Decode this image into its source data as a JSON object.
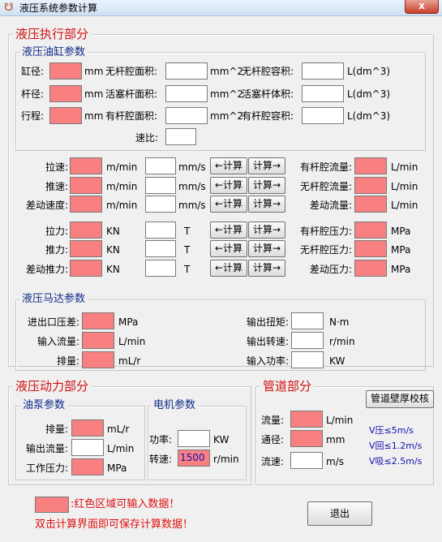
{
  "window": {
    "title": "液压系统参数计算",
    "icon": "app-icon",
    "close_label": "x"
  },
  "cylinder_section": {
    "title": "液压执行部分",
    "cyl_params": {
      "title": "液压油缸参数",
      "rows": [
        {
          "label": "缸径:",
          "unit": "mm",
          "mid_label": "无杆腔面积:",
          "mid_unit": "mm^2",
          "right_label": "无杆腔容积:",
          "right_unit": "L(dm^3)"
        },
        {
          "label": "杆径:",
          "unit": "mm",
          "mid_label": "活塞杆面积:",
          "mid_unit": "mm^2",
          "right_label": "活塞杆体积:",
          "right_unit": "L(dm^3)"
        },
        {
          "label": "行程:",
          "unit": "mm",
          "mid_label": "有杆腔面积:",
          "mid_unit": "mm^2",
          "right_label": "有杆腔容积:",
          "right_unit": "L(dm^3)"
        }
      ],
      "speed_ratio_label": "速比:"
    },
    "speed_rows": [
      {
        "label": "拉速:",
        "unit1": "m/min",
        "unit2": "mm/s",
        "btn_left": "←计算",
        "btn_right": "计算→",
        "right_label": "有杆腔流量:",
        "right_unit": "L/min"
      },
      {
        "label": "推速:",
        "unit1": "m/min",
        "unit2": "mm/s",
        "btn_left": "←计算",
        "btn_right": "计算→",
        "right_label": "无杆腔流量:",
        "right_unit": "L/min"
      },
      {
        "label": "差动速度:",
        "unit1": "m/min",
        "unit2": "mm/s",
        "btn_left": "←计算",
        "btn_right": "计算→",
        "right_label": "差动流量:",
        "right_unit": "L/min"
      }
    ],
    "force_rows": [
      {
        "label": "拉力:",
        "unit1": "KN",
        "unit2": "T",
        "btn_left": "←计算",
        "btn_right": "计算→",
        "right_label": "有杆腔压力:",
        "right_unit": "MPa"
      },
      {
        "label": "推力:",
        "unit1": "KN",
        "unit2": "T",
        "btn_left": "←计算",
        "btn_right": "计算→",
        "right_label": "无杆腔压力:",
        "right_unit": "MPa"
      },
      {
        "label": "差动推力:",
        "unit1": "KN",
        "unit2": "T",
        "btn_left": "←计算",
        "btn_right": "计算→",
        "right_label": "差动压力:",
        "right_unit": "MPa"
      }
    ]
  },
  "motor_section": {
    "title": "液压马达参数",
    "left_rows": [
      {
        "label": "进出口压差:",
        "unit": "MPa"
      },
      {
        "label": "输入流量:",
        "unit": "L/min"
      },
      {
        "label": "排量:",
        "unit": "mL/r"
      }
    ],
    "right_rows": [
      {
        "label": "输出扭矩:",
        "unit": "N·m"
      },
      {
        "label": "输出转速:",
        "unit": "r/min"
      },
      {
        "label": "输入功率:",
        "unit": "KW"
      }
    ]
  },
  "power_section": {
    "title": "液压动力部分",
    "pump": {
      "title": "油泵参数",
      "rows": [
        {
          "label": "排量:",
          "unit": "mL/r"
        },
        {
          "label": "输出流量:",
          "unit": "L/min"
        },
        {
          "label": "工作压力:",
          "unit": "MPa"
        }
      ]
    },
    "motor": {
      "title": "电机参数",
      "power_label": "功率:",
      "power_unit": "KW",
      "speed_label": "转速:",
      "speed_value": "1500",
      "speed_unit": "r/min"
    }
  },
  "pipe_section": {
    "title": "管道部分",
    "check_button": "管道壁厚校核",
    "rows": [
      {
        "label": "流量:",
        "unit": "L/min"
      },
      {
        "label": "通径:",
        "unit": "mm"
      },
      {
        "label": "流速:",
        "unit": "m/s"
      }
    ],
    "notes": [
      "V压≤5m/s",
      "V回≤1.2m/s",
      "V吸≤2.5m/s"
    ]
  },
  "footer": {
    "legend_text": ":红色区域可输入数据！",
    "hint_text": "双击计算界面即可保存计算数据！",
    "exit_button": "退出"
  },
  "colors": {
    "input_red": "#f88080",
    "section_title": "#d01010",
    "group_title": "#102a8a"
  }
}
